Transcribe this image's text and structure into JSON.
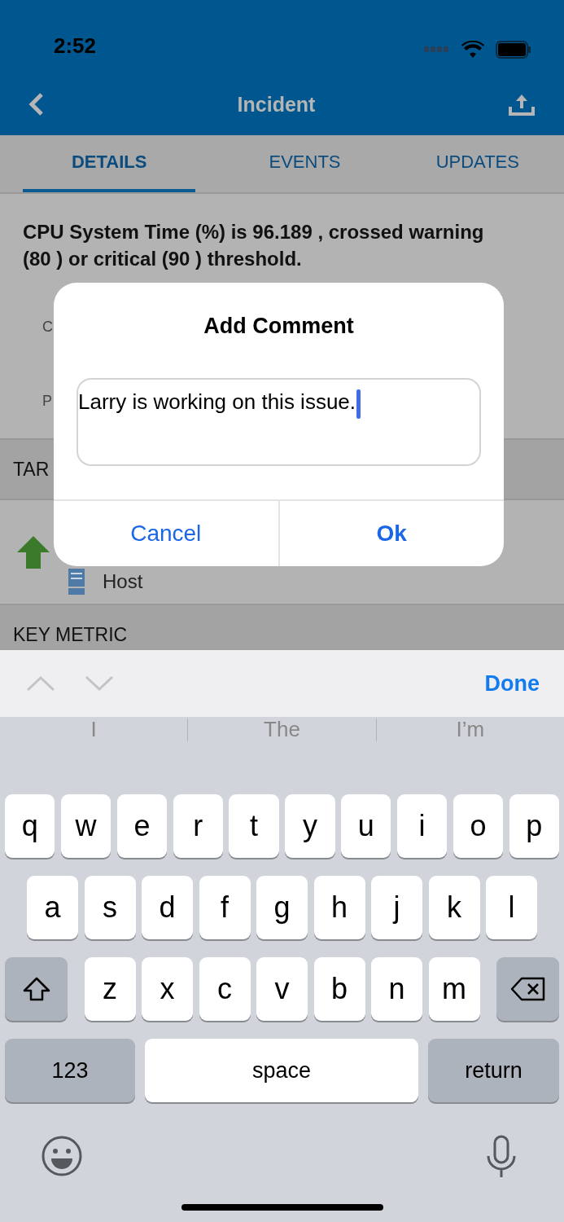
{
  "status_bar": {
    "time": "2:52"
  },
  "nav": {
    "title": "Incident"
  },
  "tabs": [
    {
      "label": "DETAILS",
      "selected": true
    },
    {
      "label": "EVENTS",
      "selected": false
    },
    {
      "label": "UPDATES",
      "selected": false
    }
  ],
  "description": "CPU System Time (%) is 96.189 , crossed warning (80 ) or critical (90 ) threshold.",
  "detail_labels": [
    "C",
    "P"
  ],
  "target_section": {
    "title": "TAR",
    "item": {
      "type": "Host"
    }
  },
  "key_metrics_section": {
    "title": "KEY METRIC"
  },
  "dialog": {
    "title": "Add Comment",
    "field": {
      "value": "Larry is working on this issue."
    },
    "buttons": [
      {
        "label": "Cancel",
        "kind": "cancel"
      },
      {
        "label": "Ok",
        "kind": "default"
      }
    ]
  },
  "keyboard_toolbar": {
    "done": "Done"
  },
  "suggestions": [
    "I",
    "The",
    "I’m"
  ],
  "keyboard_rows": [
    [
      "q",
      "w",
      "e",
      "r",
      "t",
      "y",
      "u",
      "i",
      "o",
      "p"
    ],
    [
      "a",
      "s",
      "d",
      "f",
      "g",
      "h",
      "j",
      "k",
      "l"
    ],
    [
      "z",
      "x",
      "c",
      "v",
      "b",
      "n",
      "m"
    ]
  ],
  "bottom_keys": [
    {
      "label": "123",
      "kind": "mode"
    },
    {
      "label": "space",
      "kind": "space"
    },
    {
      "label": "return",
      "kind": "return"
    }
  ]
}
